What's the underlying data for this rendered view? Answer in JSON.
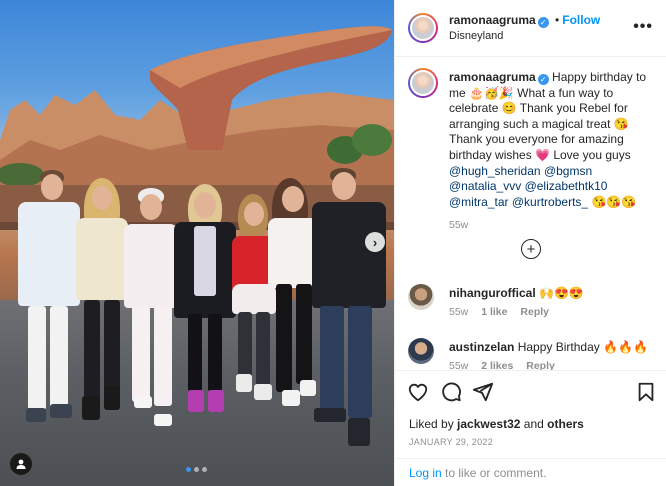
{
  "post": {
    "username": "ramonaagruma",
    "follow_label": "Follow",
    "location": "Disneyland",
    "more_label": "•••",
    "verified_mark": "✓",
    "caption_text": "Happy birthday to me 🎂🥳🎉 What a fun way to celebrate 😊 Thank you Rebel for arranging such a magical treat 😘 Thank you everyone for amazing birthday wishes 💗 Love you guys",
    "caption_mentions": [
      "@hugh_sheridan",
      "@bgmsn",
      "@natalia_vvv",
      "@elizabethtk10",
      "@mitra_tar",
      "@kurtroberts_"
    ],
    "caption_tail_emoji": "😘😘😘",
    "caption_age": "55w",
    "load_more_label": "+"
  },
  "comments": [
    {
      "username": "nihanguroffical",
      "text": "🙌😍😍",
      "age": "55w",
      "likes": "1 like",
      "reply": "Reply"
    },
    {
      "username": "austinzelan",
      "text": "Happy Birthday 🔥🔥🔥",
      "age": "55w",
      "likes": "2 likes",
      "reply": "Reply"
    }
  ],
  "actions": {
    "liked_by_prefix": "Liked by",
    "liked_by_user": "jackwest32",
    "liked_by_and": "and",
    "liked_by_others": "others",
    "date": "JANUARY 29, 2022"
  },
  "login_bar": {
    "link": "Log in",
    "rest": "to like or comment."
  },
  "photo": {
    "next_label": "›",
    "slides_total": 3,
    "slide_active": 1
  },
  "colors": {
    "accent": "#0095f6",
    "verified": "#3897f0",
    "muted": "#8e8e8e"
  }
}
